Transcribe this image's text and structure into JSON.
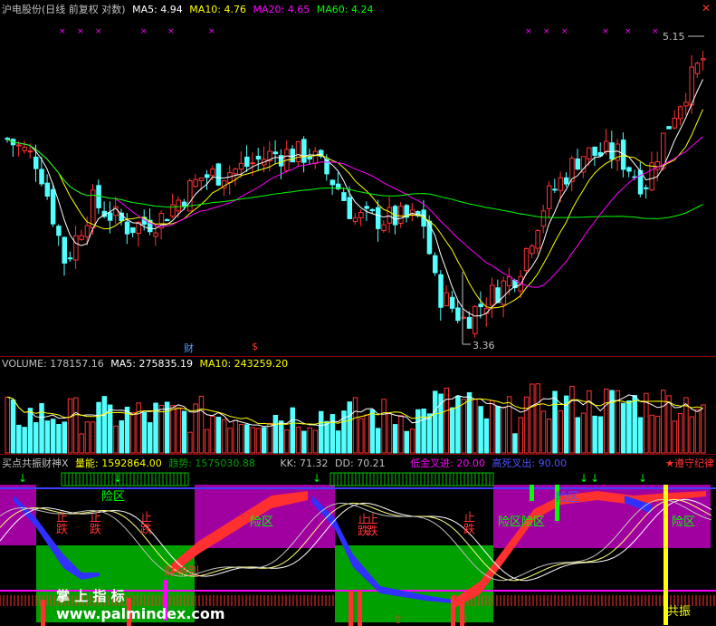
{
  "price_header": {
    "title": "沪电股份(日线 前复权 对数)",
    "ma5": "MA5: 4.94",
    "ma10": "MA10: 4.76",
    "ma20": "MA20: 4.65",
    "ma60": "MA60: 4.24"
  },
  "price_chart": {
    "high_label": "5.15",
    "low_label": "3.36",
    "marker_cai": "财",
    "marker_dollar": "$",
    "colors": {
      "up": "#ff3232",
      "down": "#54ffff",
      "ma5": "#ffffff",
      "ma10": "#ffff00",
      "ma20": "#ff00ff",
      "ma60": "#00ff00"
    }
  },
  "volume_header": {
    "volume": "VOLUME: 178157.16",
    "ma5": "MA5: 275835.19",
    "ma10": "MA10: 243259.20"
  },
  "indicator_header": {
    "name": "买点共振财神X",
    "liangneng": "量能: 1592864.00",
    "qushi": "趋势: 1575030.88",
    "kk": "KK: 71.32",
    "dd": "DD: 70.21",
    "dijin": "低金叉进: 20.00",
    "gaosi": "高死叉出: 90.00",
    "discipline": "★遵守纪律"
  },
  "indicator_labels": {
    "xianqu": "险区",
    "zhidie": "止跌",
    "zhishu": "止跌",
    "gongzhen": "共振",
    "caishen": "财神到",
    "fengxian": "风险",
    "watermark_big": "掌 上 指 标",
    "watermark_url": "www.palmindex.com"
  }
}
